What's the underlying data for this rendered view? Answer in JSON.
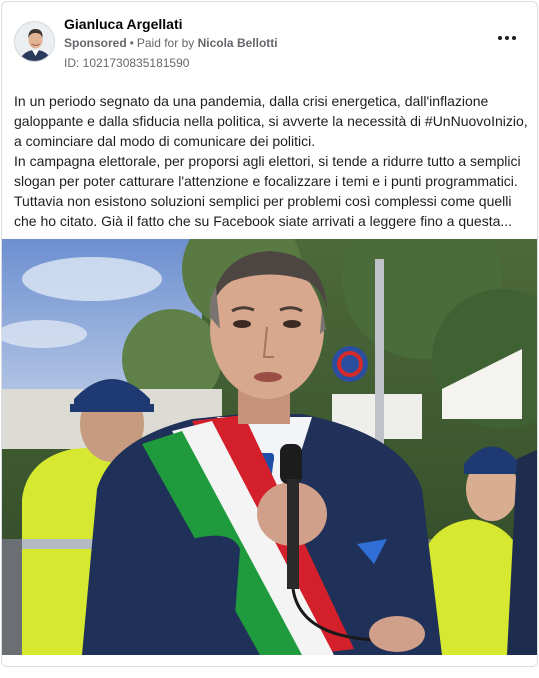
{
  "post": {
    "author": "Gianluca Argellati",
    "sponsored_label": "Sponsored",
    "separator": "•",
    "paid_prefix": "Paid for by",
    "payer": "Nicola Bellotti",
    "ad_id": "ID: 1021730835181590",
    "menu_icon": "more-horizontal-icon",
    "body_lines": [
      "In un periodo segnato da una pandemia, dalla crisi energetica, dall'inflazione galoppante e dalla sfiducia nella politica, si avverte la necessità di #UnNuovoInizio, a cominciare dal modo di comunicare dei politici.",
      "In campagna elettorale, per proporsi agli elettori, si tende a ridurre tutto a semplici slogan per poter catturare l'attenzione e focalizzare i temi e i punti programmatici. Tuttavia non esistono soluzioni semplici per problemi così complessi come quelli che ho citato. Già il fatto che su Facebook siate arrivati a leggere fino a questa..."
    ]
  },
  "colors": {
    "text_primary": "#050505",
    "text_secondary": "#65676b",
    "border": "#dadde1",
    "sash_green": "#1f9a3c",
    "sash_white": "#f4f4f4",
    "sash_red": "#d4202a",
    "suit_blue": "#1f3158",
    "vest_yellow": "#d6e830"
  }
}
